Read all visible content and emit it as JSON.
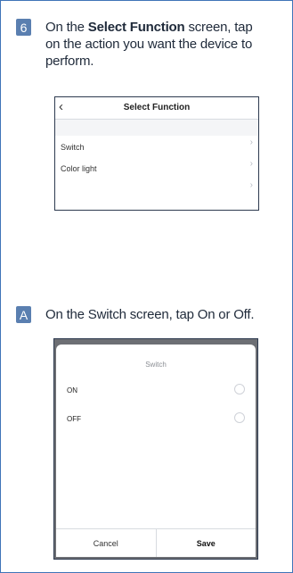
{
  "step6": {
    "badge": "6",
    "text_before": "On the ",
    "text_bold": "Select Function",
    "text_after": " screen, tap on the action you want the device to perform."
  },
  "screen1": {
    "back_icon": "chevron-left-icon",
    "title": "Select Function",
    "rows": [
      {
        "label": "Switch"
      },
      {
        "label": "Color light"
      },
      {
        "label": ""
      }
    ]
  },
  "stepA": {
    "badge": "A",
    "text": "On the Switch screen, tap On or Off."
  },
  "screen2": {
    "title": "Switch",
    "options": [
      {
        "label": "ON"
      },
      {
        "label": "OFF"
      }
    ],
    "cancel_label": "Cancel",
    "save_label": "Save"
  },
  "colors": {
    "frame_border": "#3f74b8",
    "badge": "#5a7fb0",
    "text": "#1f2a3a"
  }
}
